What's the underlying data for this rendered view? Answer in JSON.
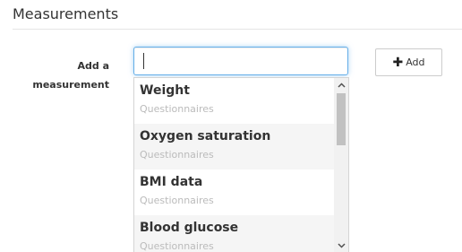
{
  "section": {
    "title": "Measurements"
  },
  "form": {
    "label_line1": "Add a",
    "label_line2": "measurement",
    "input_value": "",
    "add_button_label": "Add",
    "add_button_icon": "plus-icon"
  },
  "dropdown": {
    "items": [
      {
        "name": "Weight",
        "category": "Questionnaires"
      },
      {
        "name": "Oxygen saturation",
        "category": "Questionnaires"
      },
      {
        "name": "BMI data",
        "category": "Questionnaires"
      },
      {
        "name": "Blood glucose",
        "category": "Questionnaires"
      }
    ],
    "scroll_up_icon": "chevron-up-icon",
    "scroll_down_icon": "chevron-down-icon"
  },
  "colors": {
    "input_focus_border": "#66afe9",
    "alt_row_background": "#f5f5f5",
    "category_text": "#bbbbbb"
  }
}
